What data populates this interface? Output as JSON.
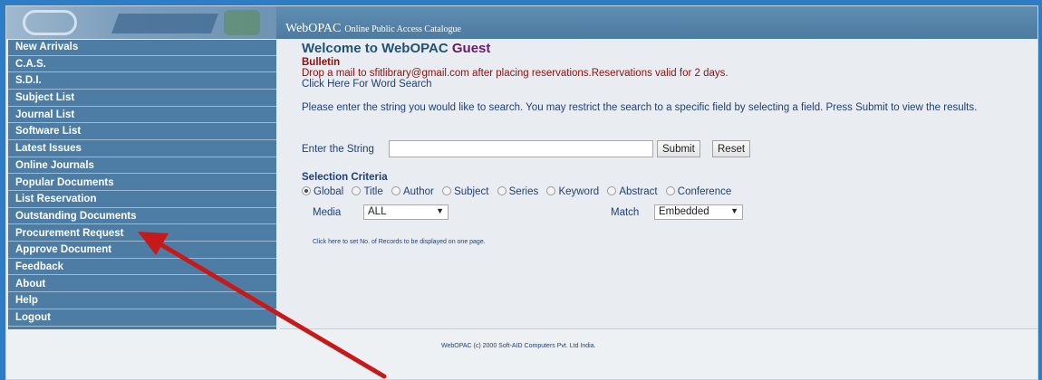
{
  "header": {
    "app_name": "WebOPAC",
    "app_subtitle": "Online Public Access Catalogue"
  },
  "sidebar": {
    "items": [
      {
        "label": "New Arrivals"
      },
      {
        "label": "C.A.S."
      },
      {
        "label": "S.D.I."
      },
      {
        "label": "Subject List"
      },
      {
        "label": "Journal List"
      },
      {
        "label": "Software List"
      },
      {
        "label": "Latest Issues"
      },
      {
        "label": "Online Journals"
      },
      {
        "label": "Popular Documents"
      },
      {
        "label": "List Reservation"
      },
      {
        "label": "Outstanding Documents"
      },
      {
        "label": "Procurement Request"
      },
      {
        "label": "Approve Document"
      },
      {
        "label": "Feedback"
      },
      {
        "label": "About"
      },
      {
        "label": "Help"
      },
      {
        "label": "Logout"
      }
    ]
  },
  "main": {
    "welcome_prefix": "Welcome to WebOPAC",
    "welcome_user": "Guest",
    "bulletin_label": "Bulletin",
    "bulletin_text": "Drop a mail to sfitlibrary@gmail.com after placing reservations.Reservations valid for 2 days.",
    "word_search_link": "Click Here For Word Search",
    "instructions": "Please enter the string you would like to search. You may restrict the search to a specific field by selecting a field. Press Submit to view the results.",
    "search": {
      "label": "Enter the String",
      "value": "",
      "submit_label": "Submit",
      "reset_label": "Reset"
    },
    "criteria": {
      "label": "Selection Criteria",
      "options": [
        "Global",
        "Title",
        "Author",
        "Subject",
        "Series",
        "Keyword",
        "Abstract",
        "Conference"
      ],
      "selected": "Global"
    },
    "media": {
      "label": "Media",
      "value": "ALL"
    },
    "match": {
      "label": "Match",
      "value": "Embedded"
    },
    "records_link": "Click here to set No. of Records to be displayed on one page."
  },
  "footer": {
    "text": "WebOPAC (c) 2000 Soft-AID Computers Pvt. Ltd India."
  },
  "colors": {
    "sidebar_bg": "#4d7da4",
    "arrow": "#c61a1a",
    "background": "#2e7cc4"
  }
}
